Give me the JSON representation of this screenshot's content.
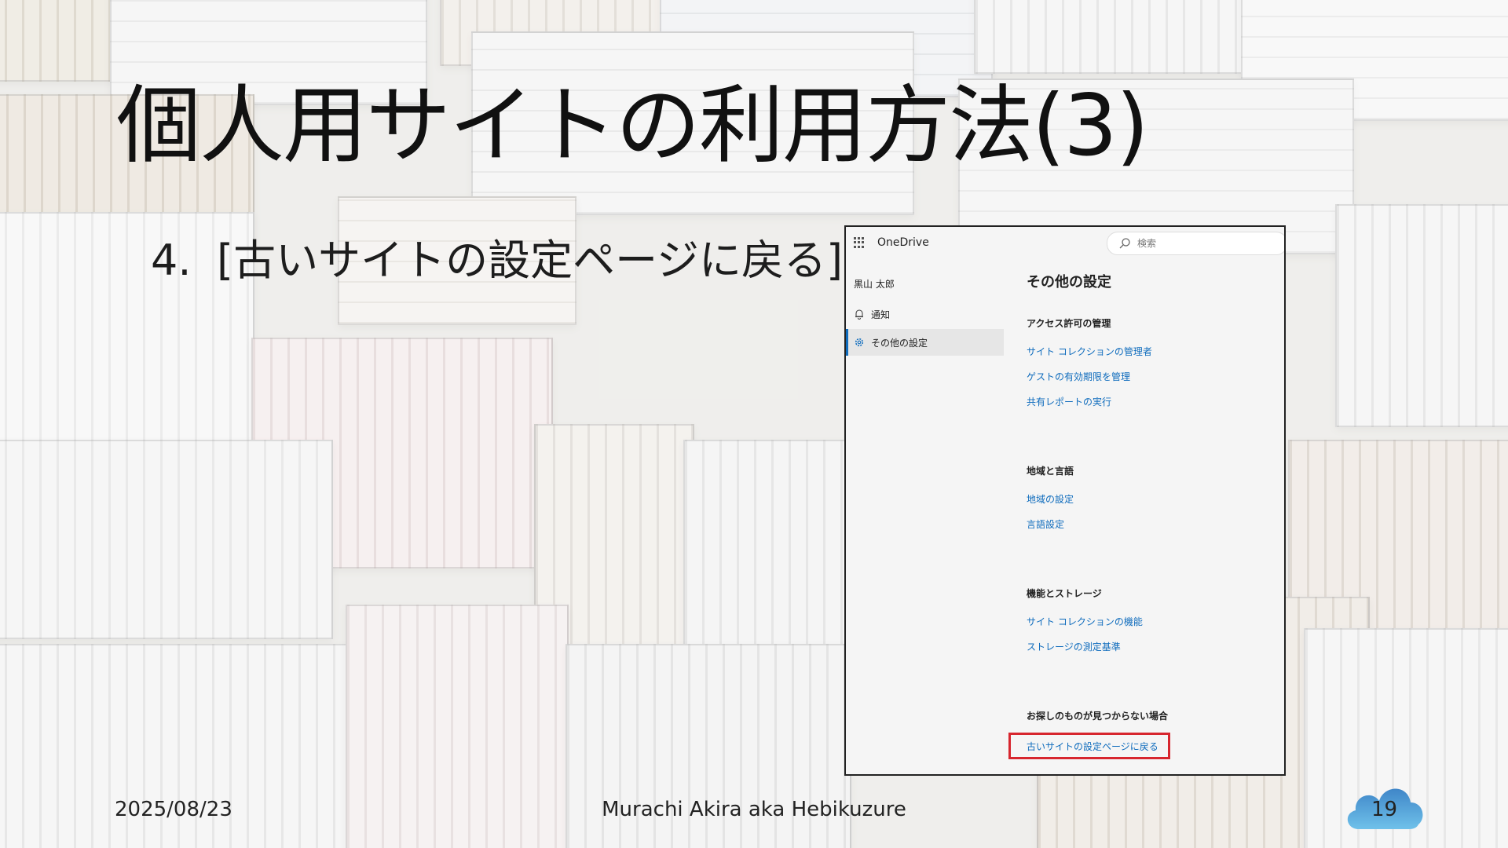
{
  "slide": {
    "title": "個人用サイトの利用方法(3)",
    "step_number": "4.",
    "step_text": "[古いサイトの設定ページに戻る]",
    "footer": {
      "date": "2025/08/23",
      "author": "Murachi Akira aka Hebikuzure",
      "page": "19"
    }
  },
  "screenshot": {
    "app_name": "OneDrive",
    "search_placeholder": "検索",
    "user_name": "黒山 太郎",
    "nav": [
      {
        "label": "通知",
        "icon": "bell-icon"
      },
      {
        "label": "その他の設定",
        "icon": "gear-icon",
        "active": true
      }
    ],
    "heading": "その他の設定",
    "sections": [
      {
        "title": "アクセス許可の管理",
        "links": [
          "サイト コレクションの管理者",
          "ゲストの有効期限を管理",
          "共有レポートの実行"
        ]
      },
      {
        "title": "地域と言語",
        "links": [
          "地域の設定",
          "言語設定"
        ]
      },
      {
        "title": "機能とストレージ",
        "links": [
          "サイト コレクションの機能",
          "ストレージの測定基準"
        ]
      },
      {
        "title": "お探しのものが見つからない場合",
        "links": [
          "古いサイトの設定ページに戻る"
        ]
      }
    ],
    "highlight_color": "#d7262e",
    "link_color": "#0f6cbd"
  }
}
